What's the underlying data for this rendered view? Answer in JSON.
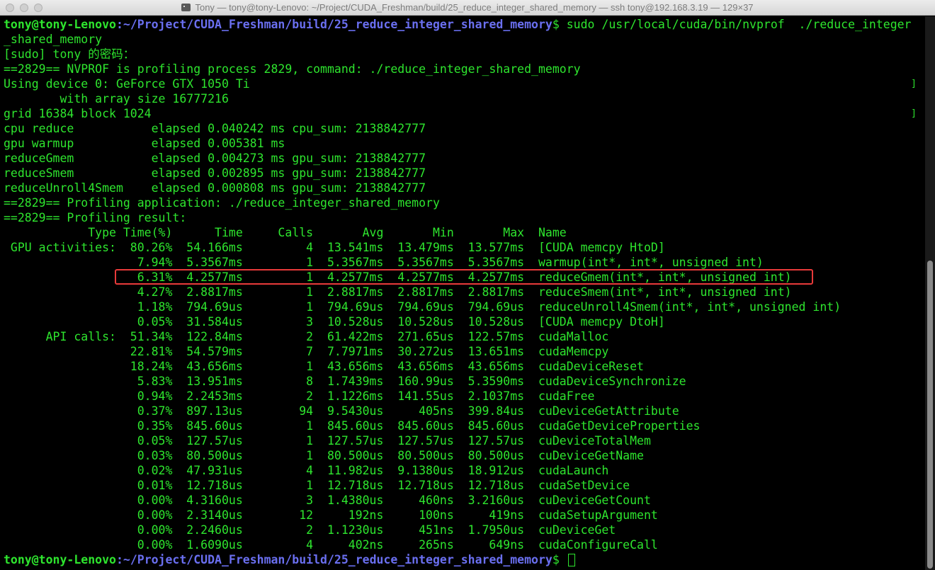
{
  "window": {
    "title": "Tony — tony@tony-Lenovo: ~/Project/CUDA_Freshman/build/25_reduce_integer_shared_memory — ssh tony@192.168.3.19 — 129×37"
  },
  "prompt": {
    "user": "tony@tony-Lenovo",
    "path": ":~/Project/CUDA_Freshman/build/25_reduce_integer_shared_memory",
    "symbol": "$ "
  },
  "command_line": "sudo /usr/local/cuda/bin/nvprof  ./reduce_integer",
  "command_wrap": "_shared_memory",
  "output": [
    "[sudo] tony 的密码：",
    "==2829== NVPROF is profiling process 2829, command: ./reduce_integer_shared_memory",
    "Using device 0: GeForce GTX 1050 Ti",
    "        with array size 16777216",
    "grid 16384 block 1024",
    "cpu reduce           elapsed 0.040242 ms cpu_sum: 2138842777",
    "gpu warmup           elapsed 0.005381 ms",
    "reduceGmem           elapsed 0.004273 ms gpu_sum: 2138842777",
    "reduceSmem           elapsed 0.002895 ms gpu_sum: 2138842777",
    "reduceUnroll4Smem    elapsed 0.000808 ms gpu_sum: 2138842777",
    "==2829== Profiling application: ./reduce_integer_shared_memory",
    "==2829== Profiling result:"
  ],
  "profile_table": {
    "headers": [
      "Type",
      "Time(%)",
      "Time",
      "Calls",
      "Avg",
      "Min",
      "Max",
      "Name"
    ],
    "rows": [
      [
        " GPU activities:",
        "80.26%",
        "54.166ms",
        "4",
        "13.541ms",
        "13.479ms",
        "13.577ms",
        "[CUDA memcpy HtoD]"
      ],
      [
        "",
        "7.94%",
        "5.3567ms",
        "1",
        "5.3567ms",
        "5.3567ms",
        "5.3567ms",
        "warmup(int*, int*, unsigned int)"
      ],
      [
        "",
        "6.31%",
        "4.2577ms",
        "1",
        "4.2577ms",
        "4.2577ms",
        "4.2577ms",
        "reduceGmem(int*, int*, unsigned int)"
      ],
      [
        "",
        "4.27%",
        "2.8817ms",
        "1",
        "2.8817ms",
        "2.8817ms",
        "2.8817ms",
        "reduceSmem(int*, int*, unsigned int)"
      ],
      [
        "",
        "1.18%",
        "794.69us",
        "1",
        "794.69us",
        "794.69us",
        "794.69us",
        "reduceUnroll4Smem(int*, int*, unsigned int)"
      ],
      [
        "",
        "0.05%",
        "31.584us",
        "3",
        "10.528us",
        "10.528us",
        "10.528us",
        "[CUDA memcpy DtoH]"
      ],
      [
        "      API calls:",
        "51.34%",
        "122.84ms",
        "2",
        "61.422ms",
        "271.65us",
        "122.57ms",
        "cudaMalloc"
      ],
      [
        "",
        "22.81%",
        "54.579ms",
        "7",
        "7.7971ms",
        "30.272us",
        "13.651ms",
        "cudaMemcpy"
      ],
      [
        "",
        "18.24%",
        "43.656ms",
        "1",
        "43.656ms",
        "43.656ms",
        "43.656ms",
        "cudaDeviceReset"
      ],
      [
        "",
        "5.83%",
        "13.951ms",
        "8",
        "1.7439ms",
        "160.99us",
        "5.3590ms",
        "cudaDeviceSynchronize"
      ],
      [
        "",
        "0.94%",
        "2.2453ms",
        "2",
        "1.1226ms",
        "141.55us",
        "2.1037ms",
        "cudaFree"
      ],
      [
        "",
        "0.37%",
        "897.13us",
        "94",
        "9.5430us",
        "405ns",
        "399.84us",
        "cuDeviceGetAttribute"
      ],
      [
        "",
        "0.35%",
        "845.60us",
        "1",
        "845.60us",
        "845.60us",
        "845.60us",
        "cudaGetDeviceProperties"
      ],
      [
        "",
        "0.05%",
        "127.57us",
        "1",
        "127.57us",
        "127.57us",
        "127.57us",
        "cuDeviceTotalMem"
      ],
      [
        "",
        "0.03%",
        "80.500us",
        "1",
        "80.500us",
        "80.500us",
        "80.500us",
        "cuDeviceGetName"
      ],
      [
        "",
        "0.02%",
        "47.931us",
        "4",
        "11.982us",
        "9.1380us",
        "18.912us",
        "cudaLaunch"
      ],
      [
        "",
        "0.01%",
        "12.718us",
        "1",
        "12.718us",
        "12.718us",
        "12.718us",
        "cudaSetDevice"
      ],
      [
        "",
        "0.00%",
        "4.3160us",
        "3",
        "1.4380us",
        "460ns",
        "3.2160us",
        "cuDeviceGetCount"
      ],
      [
        "",
        "0.00%",
        "2.3140us",
        "12",
        "192ns",
        "100ns",
        "419ns",
        "cudaSetupArgument"
      ],
      [
        "",
        "0.00%",
        "2.2460us",
        "2",
        "1.1230us",
        "451ns",
        "1.7950us",
        "cuDeviceGet"
      ],
      [
        "",
        "0.00%",
        "1.6090us",
        "4",
        "402ns",
        "265ns",
        "649ns",
        "cudaConfigureCall"
      ]
    ]
  },
  "colors": {
    "text": "#2ee52e",
    "path": "#6a6ff0",
    "highlight": "#e83a3a",
    "background": "#000000"
  }
}
